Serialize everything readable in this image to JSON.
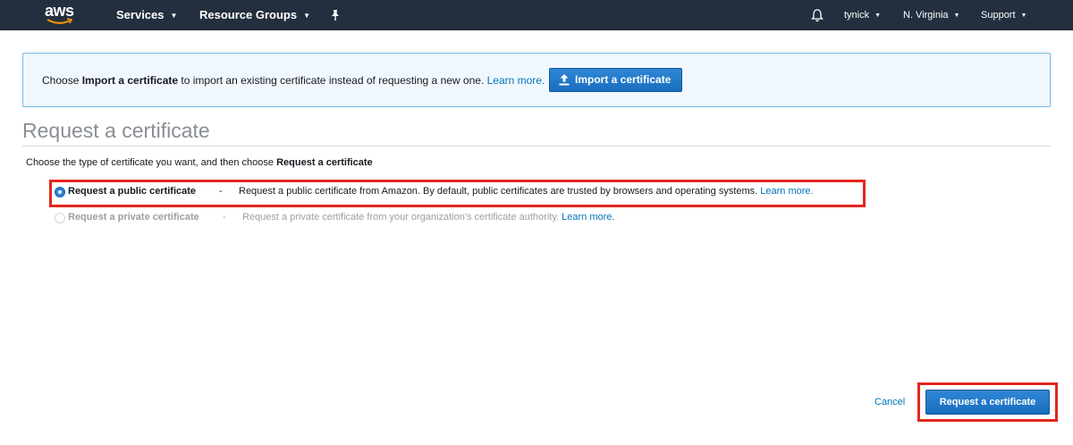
{
  "nav": {
    "logo_text": "aws",
    "services": "Services",
    "resource_groups": "Resource Groups",
    "user": "tynick",
    "region": "N. Virginia",
    "support": "Support",
    "icons": [
      "pin-icon",
      "bell-icon",
      "caret-down-icon"
    ]
  },
  "banner": {
    "text_before": "Choose ",
    "text_bold": "Import a certificate",
    "text_after": " to import an existing certificate instead of requesting a new one. ",
    "learn_more": "Learn more.",
    "button_label": "Import a certificate",
    "button_icon": "upload-icon"
  },
  "page": {
    "title": "Request a certificate",
    "instructions_before": "Choose the type of certificate you want, and then choose ",
    "instructions_bold": "Request a certificate"
  },
  "options": [
    {
      "label": "Request a public certificate",
      "dash": "-",
      "description": "Request a public certificate from Amazon. By default, public certificates are trusted by browsers and operating systems.",
      "learn_more": "Learn more.",
      "selected": true
    },
    {
      "label": "Request a private certificate",
      "dash": "-",
      "description": "Request a private certificate from your organization's certificate authority.",
      "learn_more": "Learn more.",
      "selected": false
    }
  ],
  "actions": {
    "cancel": "Cancel",
    "submit": "Request a certificate"
  },
  "colors": {
    "nav_bg": "#232f3e",
    "link": "#0073bb",
    "primary_button": "#1a6dbf",
    "banner_bg": "#f1f8fd",
    "banner_border": "#6fb6e6",
    "highlight": "#e3261d"
  }
}
